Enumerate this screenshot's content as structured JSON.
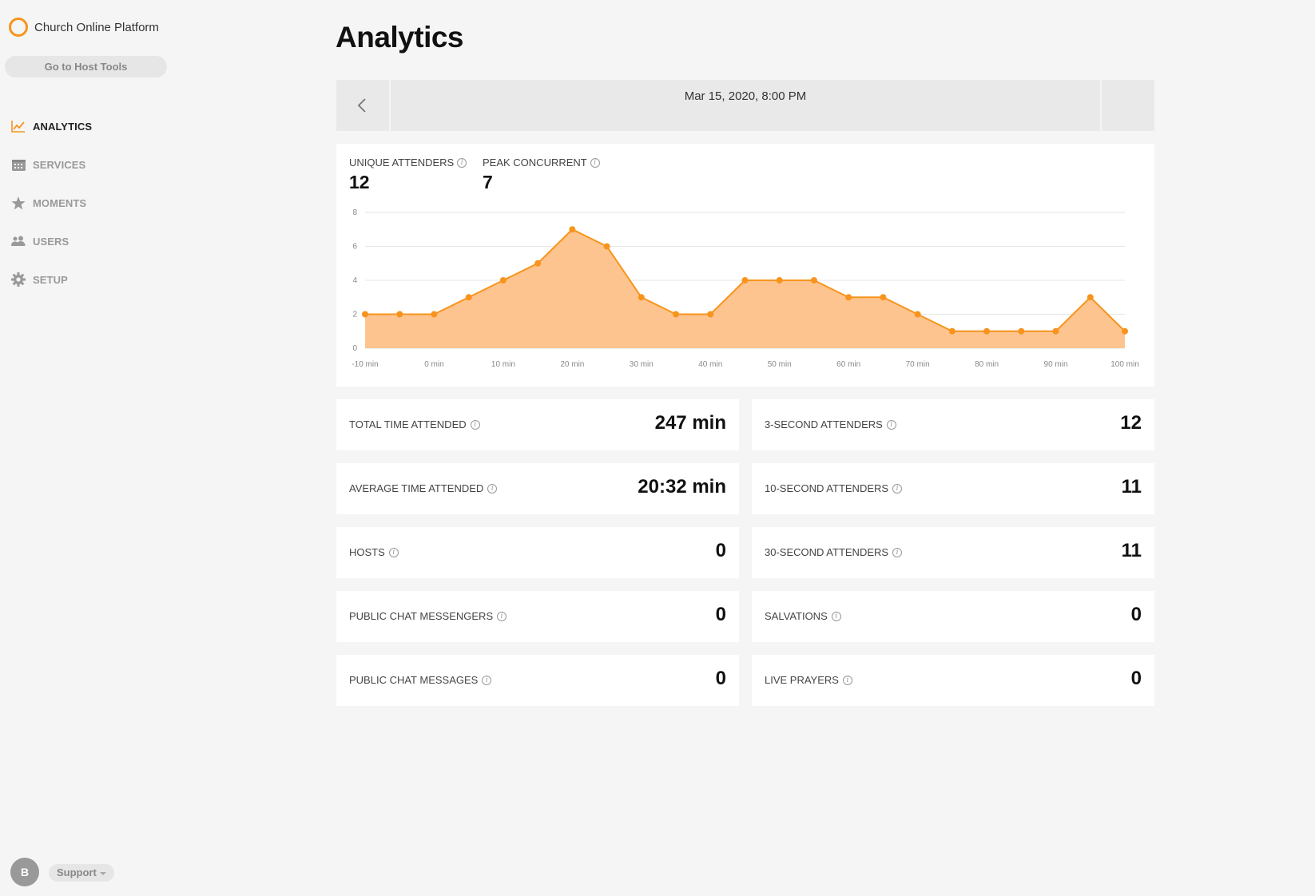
{
  "app": {
    "brand": "Church Online Platform",
    "host_tools": "Go to Host Tools",
    "accent": "#f7941d"
  },
  "nav": [
    {
      "label": "ANALYTICS",
      "icon": "chart-line-icon",
      "active": true
    },
    {
      "label": "SERVICES",
      "icon": "calendar-icon",
      "active": false
    },
    {
      "label": "MOMENTS",
      "icon": "star-icon",
      "active": false
    },
    {
      "label": "USERS",
      "icon": "users-icon",
      "active": false
    },
    {
      "label": "SETUP",
      "icon": "gear-icon",
      "active": false
    }
  ],
  "footer": {
    "avatar_initial": "B",
    "support_label": "Support"
  },
  "page": {
    "title": "Analytics",
    "date": "Mar 15, 2020, 8:00 PM"
  },
  "kpis": {
    "unique_label": "UNIQUE ATTENDERS",
    "unique_value": "12",
    "peak_label": "PEAK CONCURRENT",
    "peak_value": "7"
  },
  "chart_data": {
    "type": "area",
    "x": [
      -10,
      -5,
      0,
      5,
      10,
      15,
      20,
      25,
      30,
      35,
      40,
      45,
      50,
      55,
      60,
      65,
      70,
      75,
      80,
      85,
      90,
      95,
      100
    ],
    "series": [
      {
        "values": [
          2,
          2,
          2,
          3,
          4,
          5,
          7,
          6,
          3,
          2,
          2,
          4,
          4,
          4,
          3,
          3,
          2,
          1,
          1,
          1,
          1,
          3,
          1
        ]
      }
    ],
    "x_ticks": [
      "-10 min",
      "0 min",
      "10 min",
      "20 min",
      "30 min",
      "40 min",
      "50 min",
      "60 min",
      "70 min",
      "80 min",
      "90 min",
      "100 min"
    ],
    "y_ticks": [
      "0",
      "2",
      "4",
      "6",
      "8"
    ],
    "ylim": [
      0,
      8
    ],
    "grid": true,
    "colors": {
      "line": "#f7941d",
      "fill": "#fec48f"
    }
  },
  "stats": {
    "left": [
      {
        "label": "TOTAL TIME ATTENDED",
        "value": "247 min"
      },
      {
        "label": "AVERAGE TIME ATTENDED",
        "value": "20:32 min"
      },
      {
        "label": "HOSTS",
        "value": "0"
      },
      {
        "label": "PUBLIC CHAT MESSENGERS",
        "value": "0"
      },
      {
        "label": "PUBLIC CHAT MESSAGES",
        "value": "0"
      }
    ],
    "right": [
      {
        "label": "3-SECOND ATTENDERS",
        "value": "12"
      },
      {
        "label": "10-SECOND ATTENDERS",
        "value": "11"
      },
      {
        "label": "30-SECOND ATTENDERS",
        "value": "11"
      },
      {
        "label": "SALVATIONS",
        "value": "0"
      },
      {
        "label": "LIVE PRAYERS",
        "value": "0"
      }
    ]
  }
}
